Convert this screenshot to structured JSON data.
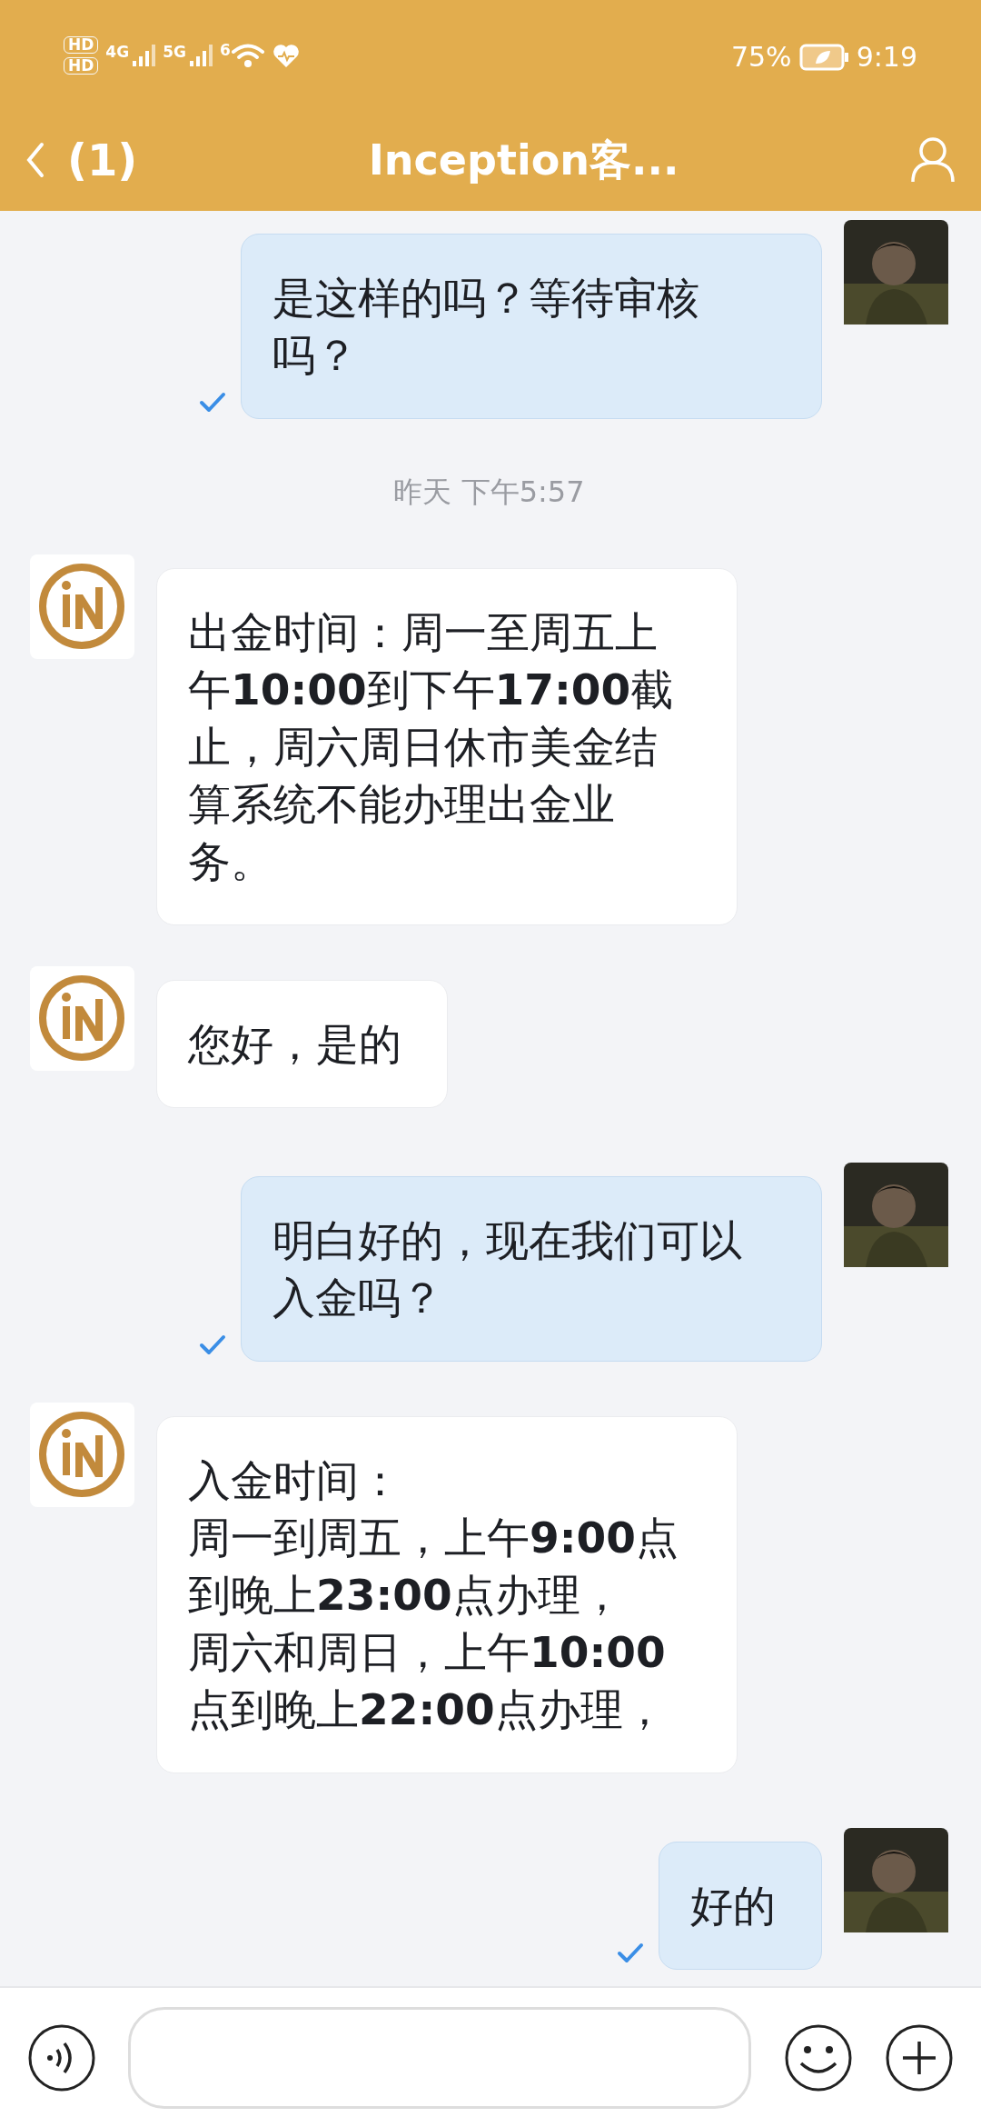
{
  "status_bar": {
    "sim_labels": [
      "HD",
      "HD"
    ],
    "network_labels": [
      "4G",
      "5G"
    ],
    "wifi_label": "6",
    "battery": "75%",
    "time": "9:19"
  },
  "header": {
    "back": "(1)",
    "title": "Inception客..."
  },
  "messages": [
    {
      "kind": "sent",
      "text": "是这样的吗？等待审核吗？",
      "read": true
    },
    {
      "kind": "time",
      "text": "昨天 下午5:57"
    },
    {
      "kind": "received",
      "text": "出金时间：周一至周五上午**10:00**到下午**17:00**截止，周六周日休市美金结算系统不能办理出金业务。"
    },
    {
      "kind": "received",
      "text": "您好，是的"
    },
    {
      "kind": "sent",
      "text": "明白好的，现在我们可以入金吗？",
      "read": true
    },
    {
      "kind": "received",
      "lines": [
        "入金时间：",
        "周一到周五，上午**9:00**点到晚上**23:00**点办理，",
        "周六和周日，上午**10:00**点到晚上**22:00**点办理，"
      ]
    },
    {
      "kind": "sent",
      "text": "好的",
      "read": true
    }
  ]
}
